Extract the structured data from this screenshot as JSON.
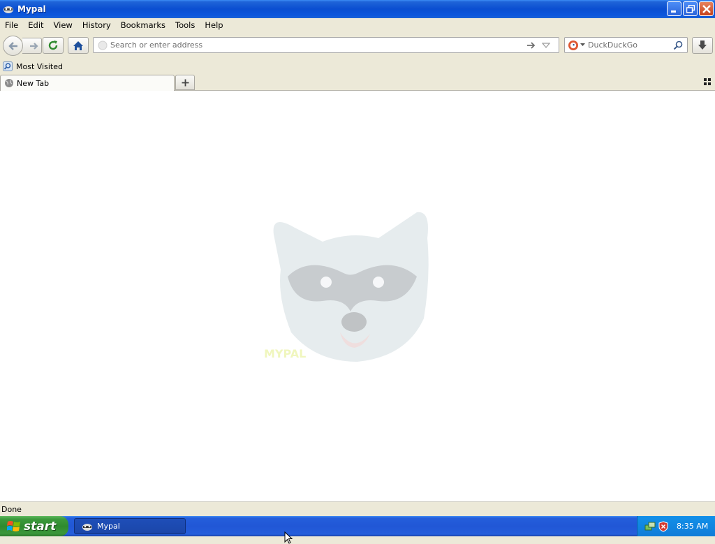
{
  "window": {
    "title": "Mypal"
  },
  "menu": [
    "File",
    "Edit",
    "View",
    "History",
    "Bookmarks",
    "Tools",
    "Help"
  ],
  "navbar": {
    "url_placeholder": "Search or enter address",
    "search_engine": "DuckDuckGo",
    "search_placeholder": "DuckDuckGo"
  },
  "bookmarks": {
    "most_visited": "Most Visited"
  },
  "tabs": [
    {
      "label": "New Tab"
    }
  ],
  "content": {
    "watermark_text": "MYPAL"
  },
  "status": {
    "text": "Done"
  },
  "taskbar": {
    "start_label": "start",
    "task_label": "Mypal",
    "clock": "8:35 AM"
  },
  "colors": {
    "titlebar": "#0a4ed1",
    "taskbar": "#245edb",
    "start_green": "#3c9a3c",
    "chrome": "#ece9d8"
  }
}
